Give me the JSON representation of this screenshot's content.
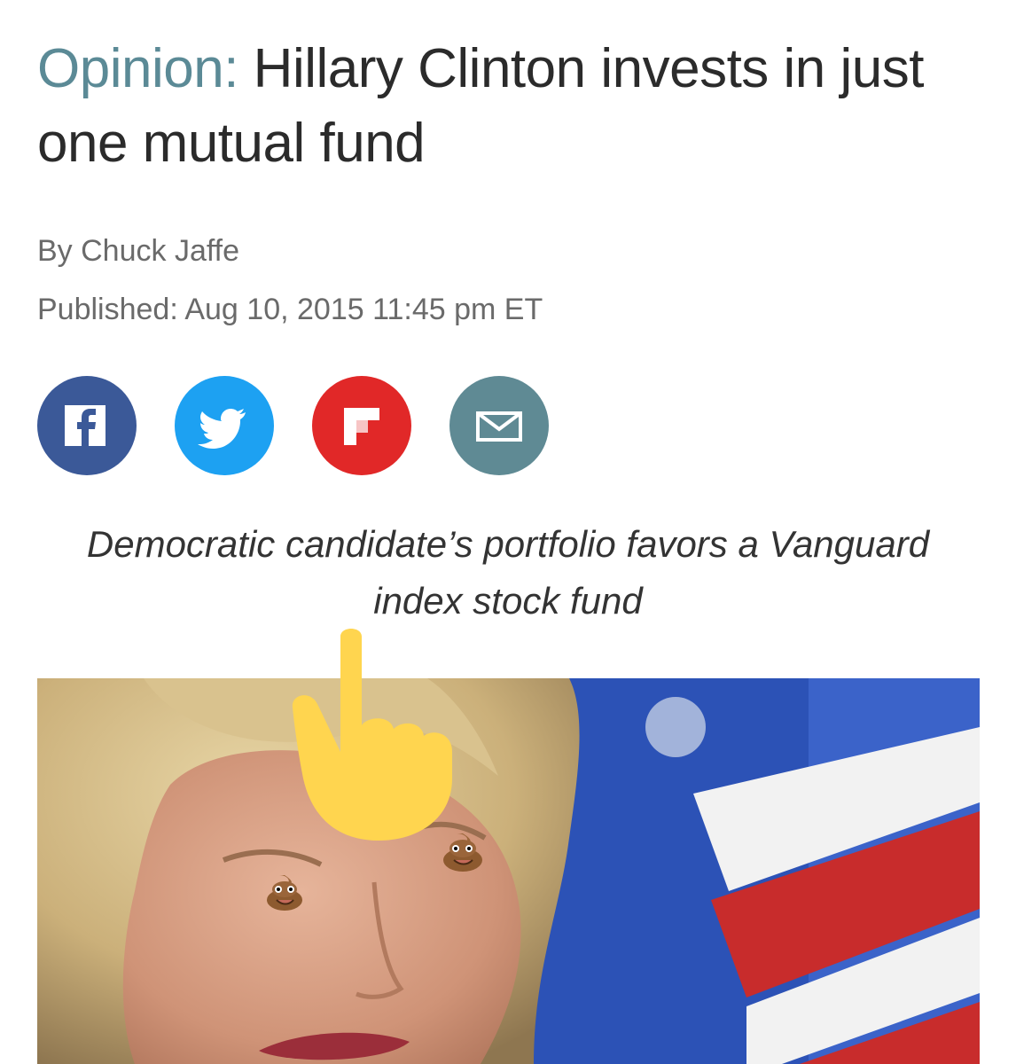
{
  "article": {
    "kicker": "Opinion:",
    "title": "Hillary Clinton invests in just one mutual fund",
    "byline": "By Chuck Jaffe",
    "published": "Published: Aug 10, 2015 11:45 pm ET",
    "dek": "Democratic candidate’s portfolio favors a Vanguard index stock fund"
  },
  "share": {
    "buttons": [
      {
        "name": "facebook",
        "icon": "facebook-icon",
        "color": "#3b5998"
      },
      {
        "name": "twitter",
        "icon": "twitter-icon",
        "color": "#1da1f2"
      },
      {
        "name": "flipboard",
        "icon": "flipboard-icon",
        "color": "#e12828"
      },
      {
        "name": "email",
        "icon": "mail-icon",
        "color": "#5f8a94"
      }
    ]
  },
  "overlays": {
    "pointer": "backhand-index-pointing-up-emoji",
    "eye_stickers": [
      "pile-of-poo-emoji",
      "pile-of-poo-emoji"
    ]
  },
  "colors": {
    "kicker": "#5b8a96",
    "headline": "#2b2b2b",
    "meta_text": "#6a6a6a",
    "pointer_yellow": "#ffd54f"
  }
}
